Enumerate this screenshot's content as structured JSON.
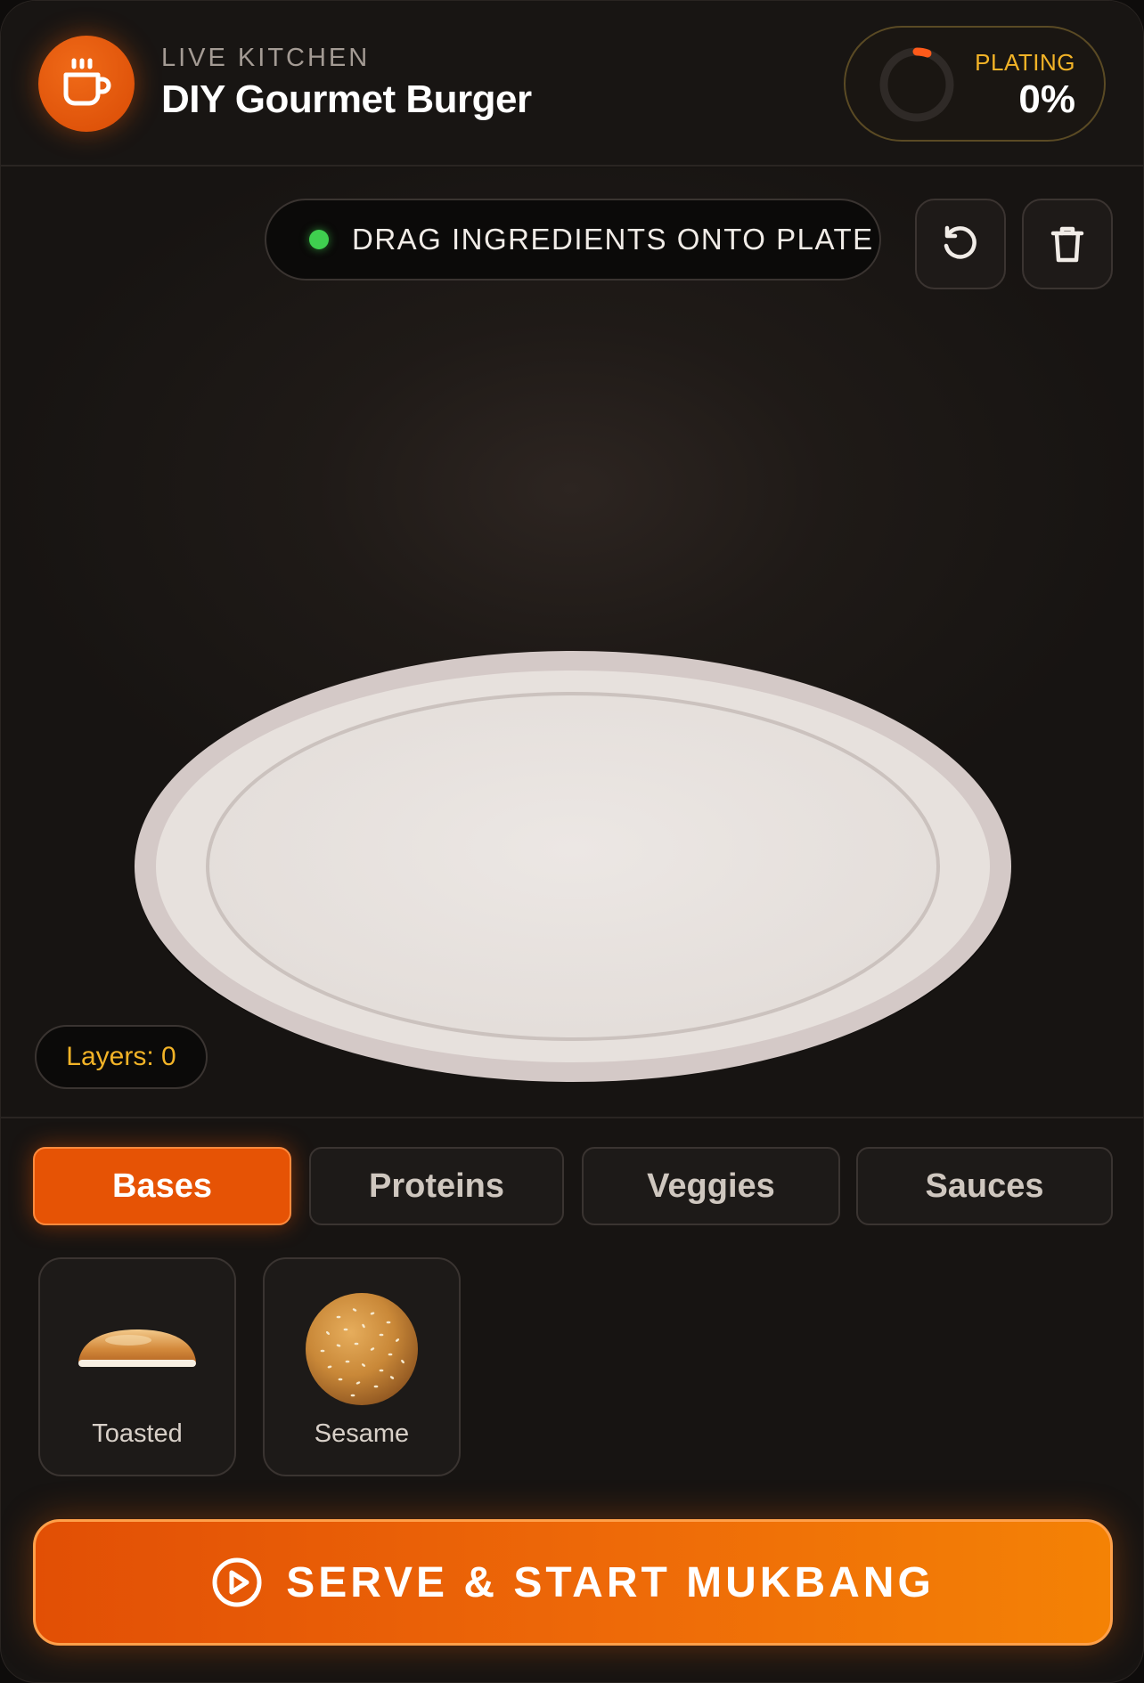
{
  "header": {
    "subtitle": "LIVE KITCHEN",
    "title": "DIY Gourmet Burger",
    "logo_icon": "coffee-cup-icon",
    "plating": {
      "label": "PLATING",
      "value_text": "0%",
      "value": 0
    }
  },
  "stage": {
    "hint": "DRAG INGREDIENTS ONTO PLATE",
    "hint_status_color": "#3fcf4f",
    "undo_icon": "undo-icon",
    "trash_icon": "trash-icon",
    "layers_text": "Layers: 0"
  },
  "tabs": [
    {
      "label": "Bases",
      "active": true
    },
    {
      "label": "Proteins",
      "active": false
    },
    {
      "label": "Veggies",
      "active": false
    },
    {
      "label": "Sauces",
      "active": false
    }
  ],
  "ingredients": [
    {
      "label": "Toasted",
      "icon": "toasted-bun-icon"
    },
    {
      "label": "Sesame",
      "icon": "sesame-bun-icon"
    }
  ],
  "serve_button": {
    "label": "SERVE & START MUKBANG",
    "icon": "play-circle-icon"
  },
  "colors": {
    "accent": "#e65305",
    "gold": "#f2b327",
    "background": "#171412"
  }
}
